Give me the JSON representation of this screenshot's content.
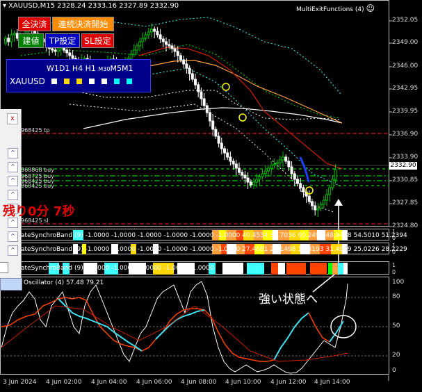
{
  "window": {
    "title": "XAUUSD,M15  2328.24 2333.16 2327.89 2332.90",
    "expert_label": "MultiExitFunctions (4)",
    "smiley": "☺"
  },
  "buttons": {
    "close_all": "全決済",
    "continuous_close_start": "連続決済開始",
    "entry": "建値",
    "tp_settings": "TP設定",
    "sl_settings": "SL設定"
  },
  "timeframe_panel": {
    "label_w1": "W1",
    "label_d1": "D1",
    "label_h4": "H4",
    "label_h1": "H1",
    "label_m30": "M30",
    "label_m5": "M5",
    "label_m1": "M1",
    "symbol": "XAUUSD",
    "squares": [
      "#ffffff",
      "#ffd700",
      "#ffd700",
      "#ffffff",
      "#ffffff",
      "#00ffff",
      "#00ffff"
    ]
  },
  "side_panel": {
    "close_glyph": "x",
    "button_glyph": "^"
  },
  "price_axis": {
    "ticks": [
      "2352.05",
      "2349.00",
      "2346.00",
      "2342.95",
      "2339.95",
      "2336.90",
      "2333.90",
      "2330.85",
      "2327.85",
      "2324.80"
    ],
    "current_price": "2332.90",
    "current_price_bg": "#ffffff"
  },
  "line_labels": {
    "tp": "968425 tp",
    "buy1": "968868 buy",
    "buy2": "968725 buy",
    "buy3": "968425 buy",
    "buy4": "968425 buy",
    "sl": "968425 sl"
  },
  "countdown": "残り0分 7秒",
  "indicators": {
    "row1_name": "ateSynchroBand (9)",
    "row1_values": "-1.0000 -1.0000 -1.0000 -1.0000 -1.0000 -1.0000 40.4534 38.7036 60.2492 48.9478 54.5010 51.2394",
    "row2_name": "ateSynchroBand (9)",
    "row2_values": "-1.0000 -1.0000 -1.0000 -1.0000 -1.0000 -1.0000 27.4681 21.1498 14.3193 31.4959 25.0226 28.2229",
    "row3_name": "ateSynchroBand (9)",
    "row3_values": "-1.0000 -1.0000 -1.0000 -1.0000 -1.0000",
    "oscillator": "Oscillator (4) 57.48 79.21",
    "row_axis_top": "1",
    "row_axis_bottom": "0"
  },
  "osc_axis": {
    "ticks": [
      "100",
      "80",
      "50",
      "20",
      "0"
    ]
  },
  "callout": "強い状態へ",
  "time_axis": [
    "3 Jun 2024",
    "4 Jun 02:00",
    "4 Jun 04:00",
    "4 Jun 06:00",
    "4 Jun 08:00",
    "4 Jun 10:00",
    "4 Jun 12:00",
    "4 Jun 14:00"
  ],
  "colors": {
    "bull": "#00c000",
    "bear": "#ffffff",
    "ma_red": "#cc2200",
    "ma_orange": "#ffa040",
    "ma_white": "#ffffff",
    "band_cyan": "#40ffff",
    "band_green": "#00ff00",
    "level_red": "#ff2020"
  }
}
